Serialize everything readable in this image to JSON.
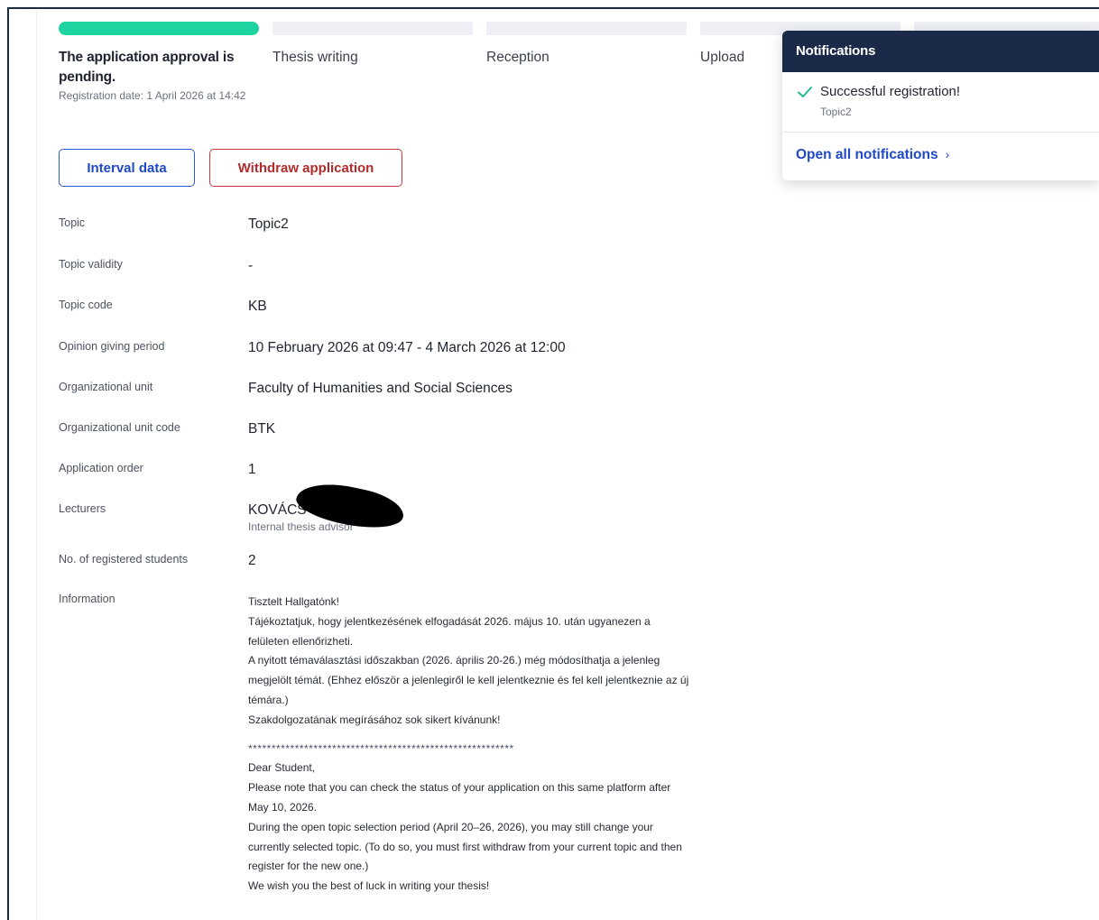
{
  "steps": [
    {
      "label": "The application approval is pending.",
      "sub": "Registration date: 1 April 2026 at 14:42",
      "active": true
    },
    {
      "label": "Thesis writing"
    },
    {
      "label": "Reception"
    },
    {
      "label": "Upload"
    },
    {
      "label": ""
    }
  ],
  "buttons": {
    "interval": "Interval data",
    "withdraw": "Withdraw application"
  },
  "colors": {
    "progress_active": "#1dd3a0",
    "primary": "#1e49c8",
    "danger": "#b32a2b",
    "notif_header": "#1c2a4a"
  },
  "details": {
    "topic": {
      "label": "Topic",
      "value": "Topic2"
    },
    "validity": {
      "label": "Topic validity",
      "value": "-"
    },
    "code": {
      "label": "Topic code",
      "value": "KB"
    },
    "period": {
      "label": "Opinion giving period",
      "value": "10 February 2026 at 09:47 - 4 March 2026 at 12:00"
    },
    "unit": {
      "label": "Organizational unit",
      "value": "Faculty of Humanities and Social Sciences"
    },
    "unit_code": {
      "label": "Organizational unit code",
      "value": "BTK"
    },
    "order": {
      "label": "Application order",
      "value": "1"
    },
    "lecturers": {
      "label": "Lecturers",
      "value": "KOVÁCS",
      "role": "Internal thesis advisor"
    },
    "students": {
      "label": "No. of registered students",
      "value": "2"
    },
    "information": {
      "label": "Information"
    }
  },
  "information": {
    "hu": [
      "Tisztelt Hallgatónk!",
      "Tájékoztatjuk, hogy jelentkezésének elfogadását 2026. május 10. után ugyanezen a felületen ellenőrizheti.",
      "A nyitott témaválasztási időszakban (2026. április 20-26.) még módosíthatja a jelenleg megjelölt témát. (Ehhez először a jelenlegiről le kell jelentkeznie és fel kell jelentkeznie az új témára.)",
      "Szakdolgozatának megírásához sok sikert kívánunk!"
    ],
    "separator": "*********************************************************",
    "en": [
      "Dear Student,",
      "Please note that you can check the status of your application on this same platform after May 10, 2026.",
      "During the open topic selection period (April 20–26, 2026), you may still change your currently selected topic. (To do so, you must first withdraw from your current topic and then register for the new one.)",
      "We wish you the best of luck in writing your thesis!"
    ]
  },
  "notifications": {
    "title": "Notifications",
    "item_title": "Successful registration!",
    "item_sub": "Topic2",
    "link": "Open all notifications",
    "check_icon": "check-icon",
    "chevron_icon": "chevron-right-icon"
  }
}
